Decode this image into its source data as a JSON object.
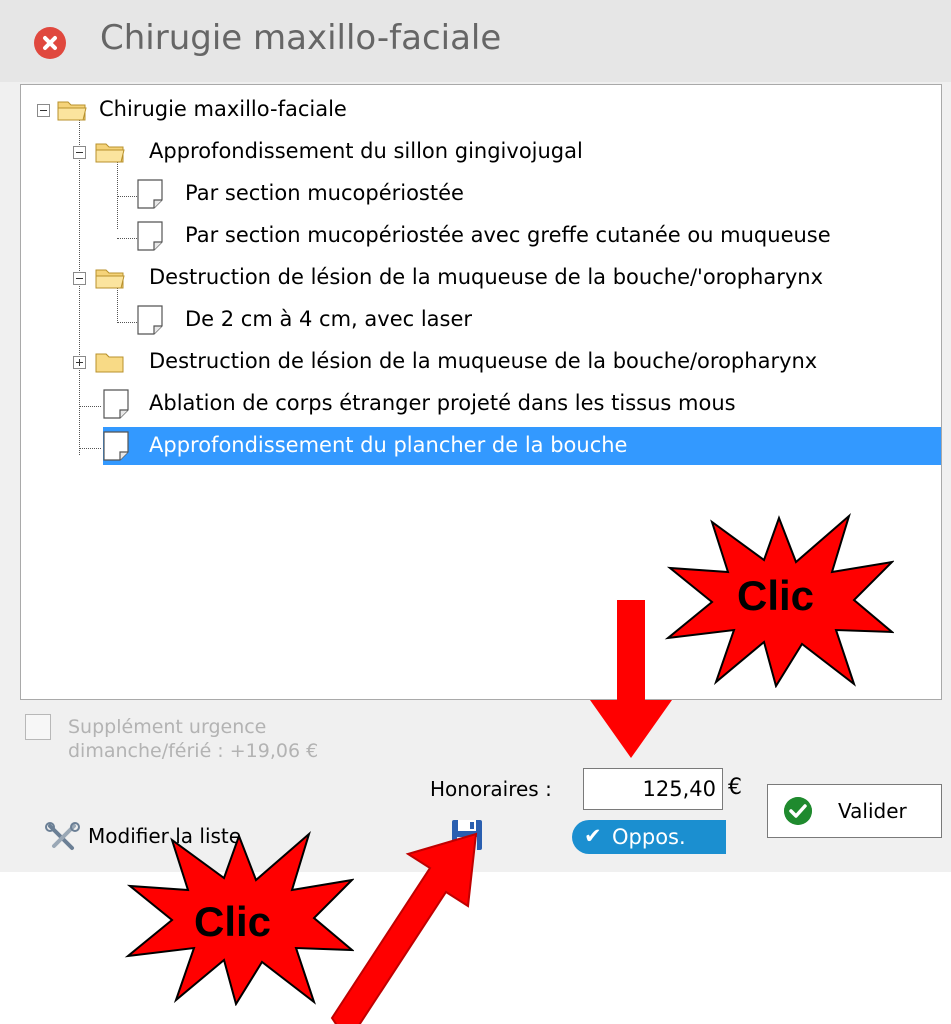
{
  "window": {
    "title": "Chirugie maxillo-faciale"
  },
  "tree": {
    "nodes": [
      {
        "label": "Chirugie maxillo-faciale",
        "type": "folder",
        "expanded": true
      },
      {
        "label": "Approfondissement du sillon gingivojugal",
        "type": "folder",
        "expanded": true
      },
      {
        "label": "Par section mucopériostée",
        "type": "document"
      },
      {
        "label": "Par section mucopériostée avec greffe cutanée ou muqueuse",
        "type": "document"
      },
      {
        "label": "Destruction de lésion de la muqueuse de la bouche/'oropharynx",
        "type": "folder",
        "expanded": true
      },
      {
        "label": "De 2 cm à 4 cm, avec laser",
        "type": "document"
      },
      {
        "label": "Destruction de lésion de la muqueuse de la bouche/oropharynx",
        "type": "folder",
        "expanded": false
      },
      {
        "label": "Ablation de corps étranger projeté dans les tissus mous",
        "type": "document"
      },
      {
        "label": "Approfondissement du plancher de la bouche",
        "type": "document",
        "selected": true
      }
    ]
  },
  "urgence": {
    "line1": "Supplément urgence",
    "line2": "dimanche/férié : +19,06 €",
    "checked": false
  },
  "honoraires": {
    "label": "Honoraires :",
    "value": "125,40",
    "currency": "€"
  },
  "buttons": {
    "valider": "Valider",
    "oppos": "Oppos.",
    "modifier": "Modifier la liste"
  },
  "annotations": {
    "clic_top": "Clic",
    "clic_bottom": "Clic"
  },
  "colors": {
    "selection": "#3399ff",
    "oppos": "#1b8fd0",
    "starburst": "#ff0000",
    "arrow": "#ff0000"
  },
  "icons": {
    "close": "close-icon",
    "folder": "folder-icon",
    "document": "document-icon",
    "save": "floppy-disk-icon",
    "tools": "tools-icon",
    "check": "checkmark-icon"
  }
}
